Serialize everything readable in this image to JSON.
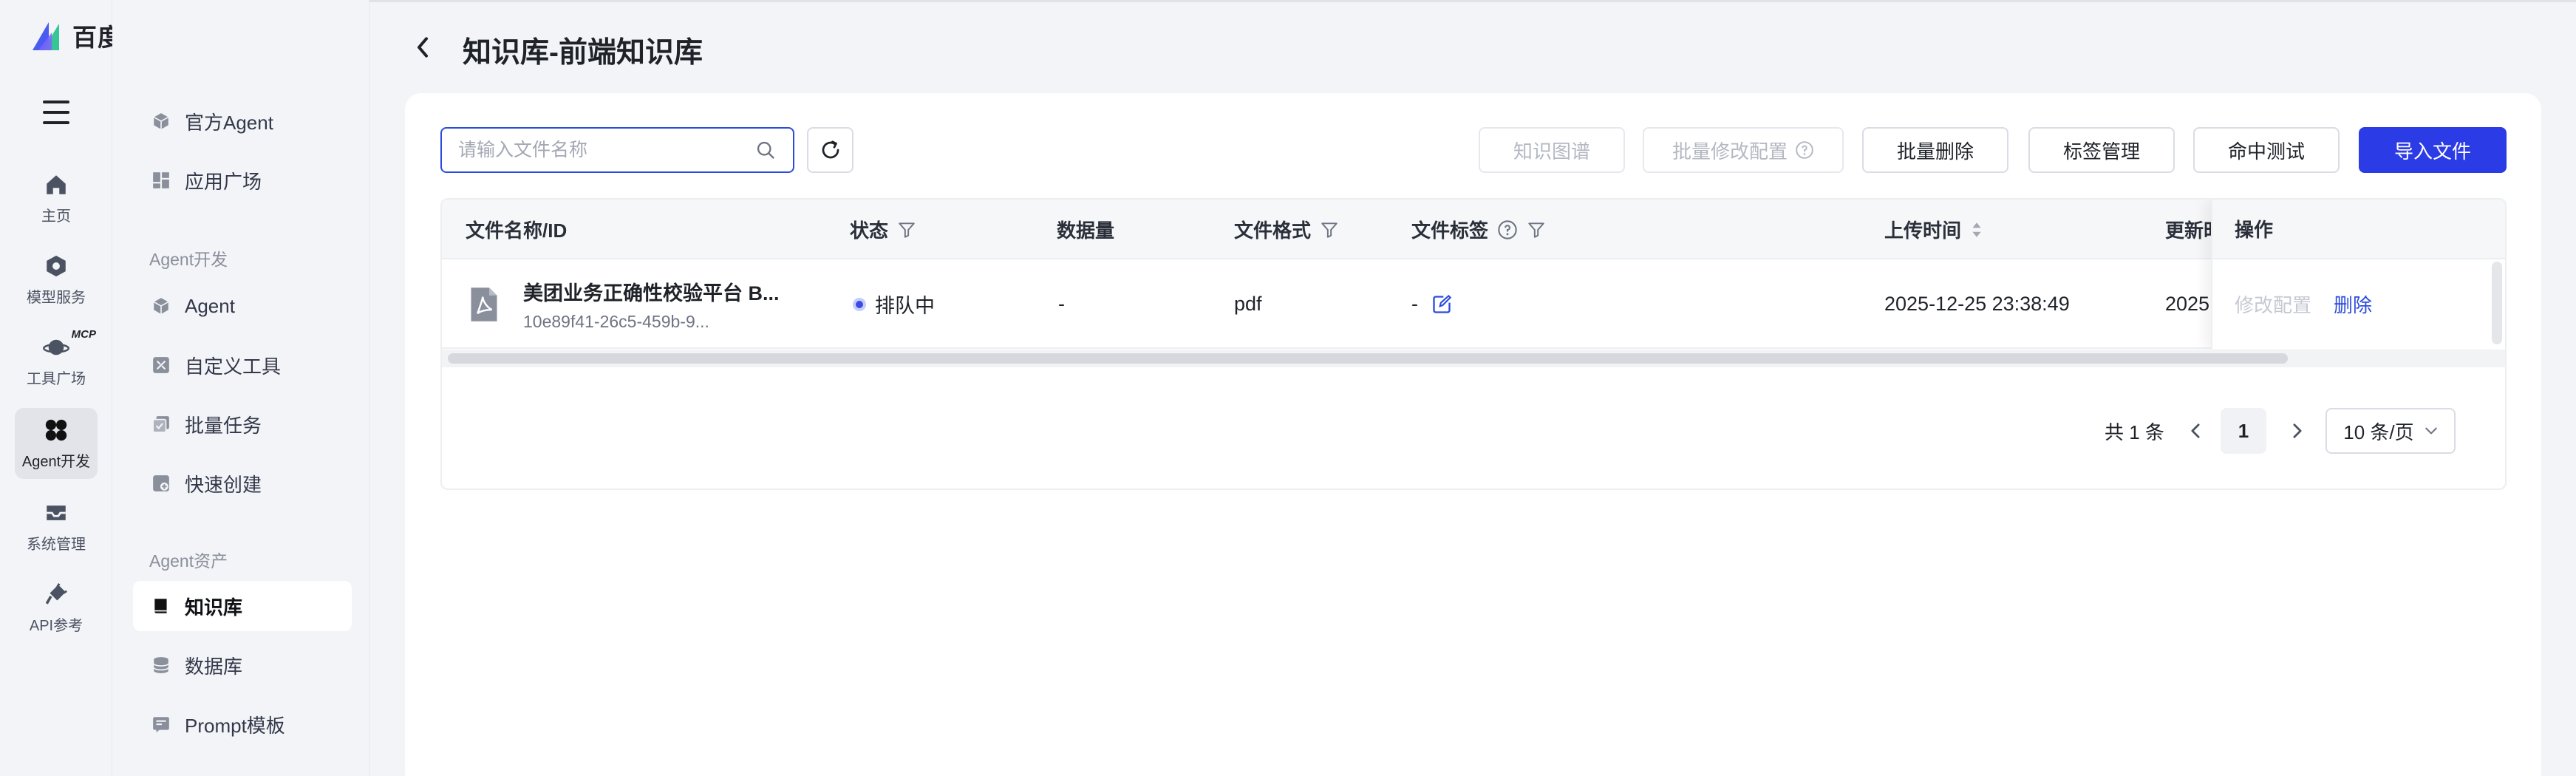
{
  "app": {
    "name": "百度千帆"
  },
  "rail": {
    "items": [
      {
        "label": "主页",
        "icon": "home-icon"
      },
      {
        "label": "模型服务",
        "icon": "model-icon"
      },
      {
        "label": "工具广场",
        "icon": "planet-icon",
        "badge": "MCP"
      },
      {
        "label": "Agent开发",
        "icon": "agent-dev-icon"
      },
      {
        "label": "系统管理",
        "icon": "inbox-icon"
      },
      {
        "label": "API参考",
        "icon": "plug-icon"
      }
    ],
    "active": "Agent开发"
  },
  "sidebar": {
    "top_items": [
      {
        "label": "官方Agent",
        "icon": "cube-icon"
      },
      {
        "label": "应用广场",
        "icon": "grid-icon"
      }
    ],
    "sections": [
      {
        "title": "Agent开发",
        "items": [
          {
            "label": "Agent",
            "icon": "cube-icon"
          },
          {
            "label": "自定义工具",
            "icon": "tools-icon"
          },
          {
            "label": "批量任务",
            "icon": "batch-icon"
          },
          {
            "label": "快速创建",
            "icon": "quick-create-icon"
          }
        ]
      },
      {
        "title": "Agent资产",
        "items": [
          {
            "label": "知识库",
            "icon": "book-icon"
          },
          {
            "label": "数据库",
            "icon": "database-icon"
          },
          {
            "label": "Prompt模板",
            "icon": "template-icon"
          }
        ]
      }
    ],
    "active": "知识库"
  },
  "page": {
    "title": "知识库-前端知识库"
  },
  "toolbar": {
    "search_placeholder": "请输入文件名称",
    "buttons": {
      "graph": "知识图谱",
      "batch_config": "批量修改配置",
      "batch_delete": "批量删除",
      "tag_manage": "标签管理",
      "hit_test": "命中测试",
      "import": "导入文件"
    }
  },
  "table": {
    "columns": {
      "name": "文件名称/ID",
      "status": "状态",
      "data_count": "数据量",
      "format": "文件格式",
      "tags": "文件标签",
      "upload_time": "上传时间",
      "update_time": "更新时",
      "actions": "操作"
    },
    "rows": [
      {
        "name": "美团业务正确性校验平台 B...",
        "id": "10e89f41-26c5-459b-9...",
        "status": "排队中",
        "data_count": "-",
        "format": "pdf",
        "tags": "-",
        "upload_time": "2025-12-25 23:38:49",
        "update_time": "2025",
        "action_edit": "修改配置",
        "action_delete": "删除"
      }
    ]
  },
  "pagination": {
    "total": "共 1 条",
    "current": "1",
    "page_size": "10 条/页"
  },
  "colors": {
    "primary": "#2b3be5",
    "link": "#2b4bdc",
    "background": "#f3f4f7"
  }
}
